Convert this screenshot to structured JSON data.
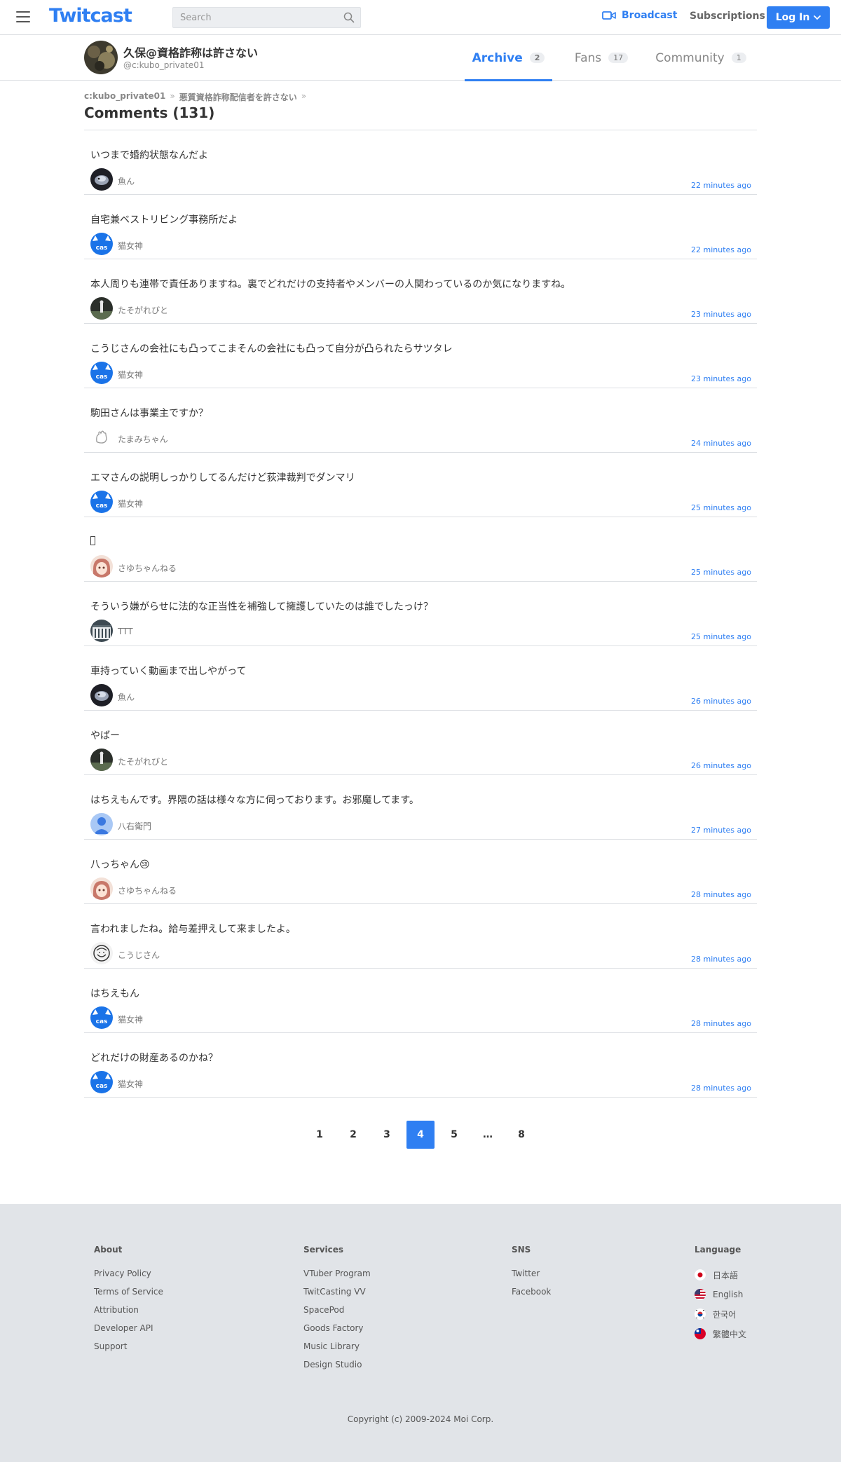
{
  "topnav": {
    "logo": "Twitcast",
    "search_placeholder": "Search",
    "broadcast_label": "Broadcast",
    "subscriptions_label": "Subscriptions",
    "login_label": "Log In"
  },
  "user": {
    "name": "久保@資格詐称は許さない",
    "id": "@c:kubo_private01"
  },
  "tabs": [
    {
      "label": "Archive",
      "count": "2"
    },
    {
      "label": "Fans",
      "count": "17"
    },
    {
      "label": "Community",
      "count": "1"
    }
  ],
  "breadcrumb": [
    {
      "label": "c:kubo_private01",
      "sep": "»"
    },
    {
      "label": "悪質資格詐称配信者を許さない",
      "sep": "»"
    }
  ],
  "page_title": "Comments (131)",
  "comments": [
    {
      "text": "いつまで婚約状態なんだよ",
      "user": "魚ん",
      "time": "22 minutes ago",
      "avatar": "fish-avatar"
    },
    {
      "text": "自宅兼ベストリビング事務所だよ",
      "user": "猫女神",
      "time": "22 minutes ago",
      "avatar": "cas-cat-avatar"
    },
    {
      "text": "本人周りも連帯で責任ありますね。裏でどれだけの支持者やメンバーの人関わっているのか気になりますね。",
      "user": "たそがれびと",
      "time": "23 minutes ago",
      "avatar": "dark-figure-avatar"
    },
    {
      "text": "こうじさんの会社にも凸ってこまそんの会社にも凸って自分が凸られたらサツタレ",
      "user": "猫女神",
      "time": "23 minutes ago",
      "avatar": "cas-cat-avatar"
    },
    {
      "text": "駒田さんは事業主ですか？",
      "user": "たまみちゃん",
      "time": "24 minutes ago",
      "avatar": "hand-wave-avatar"
    },
    {
      "text": "エマさんの説明しっかりしてるんだけど荻津裁判でダンマリ",
      "user": "猫女神",
      "time": "25 minutes ago",
      "avatar": "cas-cat-avatar"
    },
    {
      "text": "",
      "user": "さゆちゃんねる",
      "time": "25 minutes ago",
      "avatar": "anime-girl-avatar"
    },
    {
      "text": "そういう嫌がらせに法的な正当性を補強して擁護していたのは誰でしたっけ？",
      "user": "TTT",
      "time": "25 minutes ago",
      "avatar": "building-avatar"
    },
    {
      "text": "車持っていく動画まで出しやがって",
      "user": "魚ん",
      "time": "26 minutes ago",
      "avatar": "fish-avatar"
    },
    {
      "text": "やばー",
      "user": "たそがれびと",
      "time": "26 minutes ago",
      "avatar": "dark-figure-avatar"
    },
    {
      "text": "はちえもんです。界隈の話は様々な方に伺っております。お邪魔してます。",
      "user": "八右衛門",
      "time": "27 minutes ago",
      "avatar": "default-person-avatar"
    },
    {
      "text": "八っちゃん😢",
      "user": "さゆちゃんねる",
      "time": "28 minutes ago",
      "avatar": "anime-girl-avatar"
    },
    {
      "text": "言われましたね。給与差押えして来ましたよ。",
      "user": "こうじさん",
      "time": "28 minutes ago",
      "avatar": "sketch-avatar"
    },
    {
      "text": "はちえもん",
      "user": "猫女神",
      "time": "28 minutes ago",
      "avatar": "cas-cat-avatar"
    },
    {
      "text": "どれだけの財産あるのかね？",
      "user": "猫女神",
      "time": "28 minutes ago",
      "avatar": "cas-cat-avatar"
    }
  ],
  "pagination": [
    "1",
    "2",
    "3",
    "4",
    "5",
    "…",
    "8"
  ],
  "pagination_current": "4",
  "footer": {
    "about": {
      "heading": "About",
      "links": [
        "Privacy Policy",
        "Terms of Service",
        "Attribution",
        "Developer API",
        "Support"
      ]
    },
    "services": {
      "heading": "Services",
      "links": [
        "VTuber Program",
        "TwitCasting VV",
        "SpacePod",
        "Goods Factory",
        "Music Library",
        "Design Studio"
      ]
    },
    "sns": {
      "heading": "SNS",
      "links": [
        "Twitter",
        "Facebook"
      ]
    },
    "language": {
      "heading": "Language",
      "items": [
        {
          "label": "日本語",
          "flag": "japan-flag-icon"
        },
        {
          "label": "English",
          "flag": "usa-flag-icon"
        },
        {
          "label": "한국어",
          "flag": "korea-flag-icon"
        },
        {
          "label": "繁體中文",
          "flag": "taiwan-flag-icon"
        }
      ]
    },
    "copyright": "Copyright (c) 2009-2024 Moi Corp."
  },
  "colors": {
    "accent": "#2f7ff2",
    "footer_bg": "#e1e4e8",
    "divider": "#dcdfe3"
  }
}
